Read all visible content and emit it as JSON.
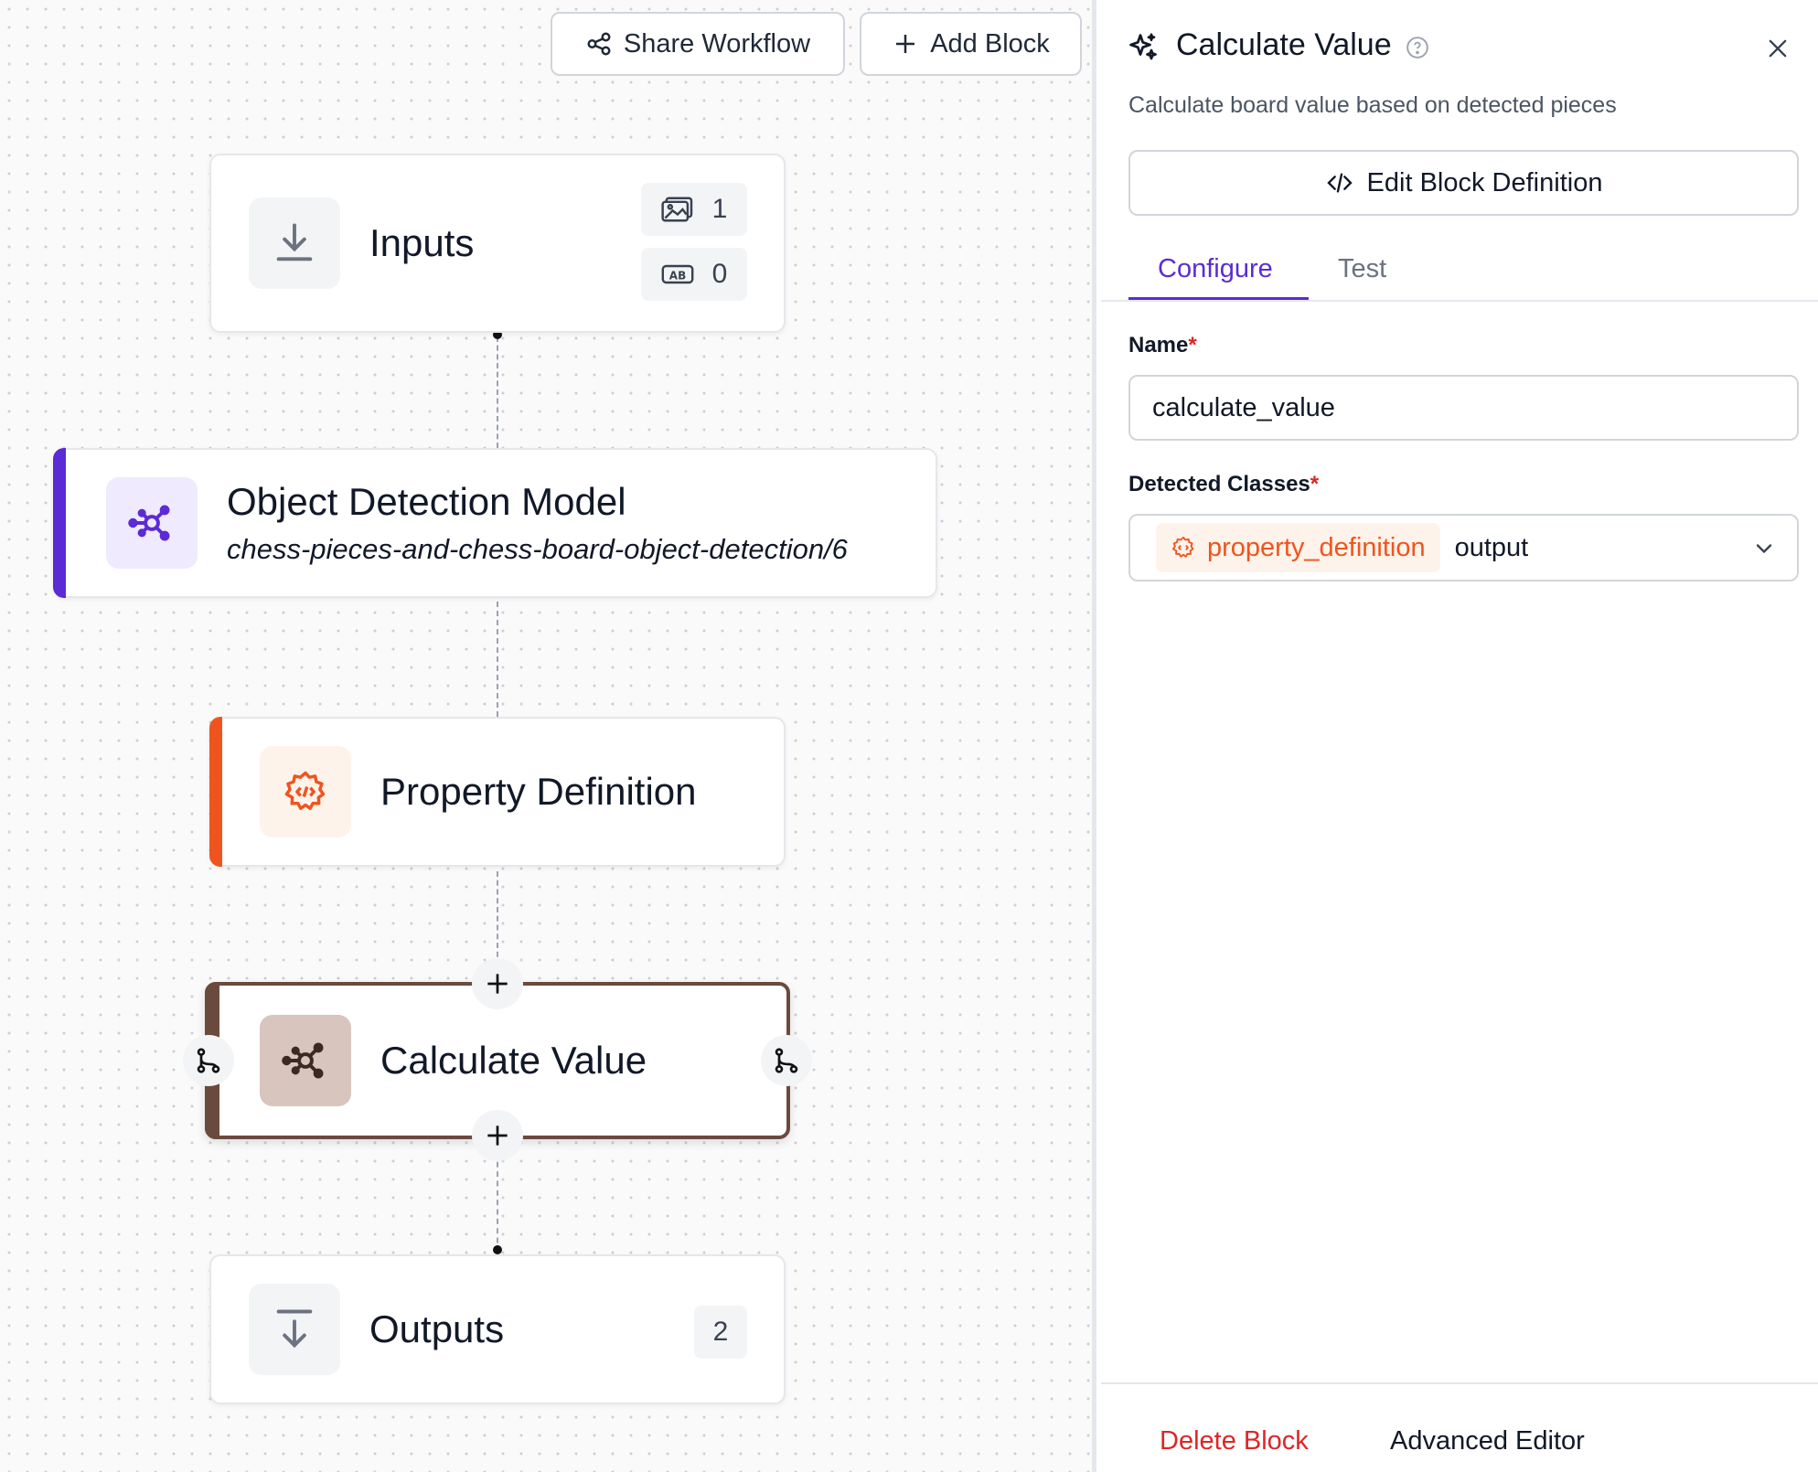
{
  "toolbar": {
    "share_label": "Share Workflow",
    "add_label": "Add Block"
  },
  "nodes": {
    "inputs": {
      "title": "Inputs",
      "image_count": "1",
      "text_count": "0"
    },
    "object_detection": {
      "title": "Object Detection Model",
      "subtitle": "chess-pieces-and-chess-board-object-detection/6",
      "accent": "#5b2bd6"
    },
    "property_definition": {
      "title": "Property Definition",
      "accent": "#f0541e"
    },
    "calculate_value": {
      "title": "Calculate Value",
      "accent": "#6b4a3e"
    },
    "outputs": {
      "title": "Outputs",
      "count": "2"
    }
  },
  "panel": {
    "title": "Calculate Value",
    "description": "Calculate board value based on detected pieces",
    "edit_definition_label": "Edit Block Definition",
    "tabs": [
      {
        "label": "Configure",
        "active": true
      },
      {
        "label": "Test",
        "active": false
      }
    ],
    "name_label": "Name",
    "name_value": "calculate_value",
    "detected_classes_label": "Detected Classes",
    "detected_classes_tag": "property_definition",
    "detected_classes_value": "output",
    "required_mark": "*",
    "delete_label": "Delete Block",
    "advanced_label": "Advanced Editor"
  },
  "colors": {
    "primary": "#5b2bd6",
    "orange": "#f0541e",
    "danger": "#dc2626"
  }
}
